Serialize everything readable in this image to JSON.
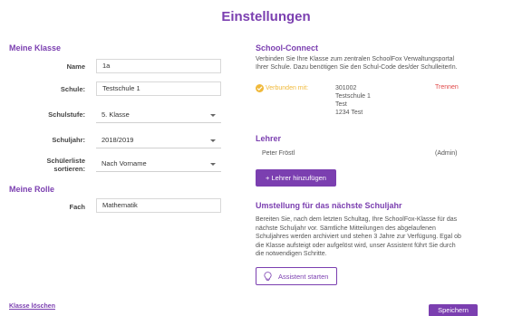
{
  "page": {
    "title": "Einstellungen"
  },
  "my_class": {
    "section_title": "Meine Klasse",
    "name_label": "Name",
    "name_value": "1a",
    "school_label": "Schule:",
    "school_value": "Testschule 1",
    "level_label": "Schulstufe:",
    "level_value": "5. Klasse",
    "year_label": "Schuljahr:",
    "year_value": "2018/2019",
    "sort_label_line1": "Schülerliste",
    "sort_label_line2": "sortieren:",
    "sort_value": "Nach Vorname"
  },
  "my_role": {
    "section_title": "Meine Rolle",
    "subject_label": "Fach",
    "subject_value": "Mathematik"
  },
  "school_connect": {
    "section_title": "School-Connect",
    "description_line1": "Verbinden Sie Ihre Klasse zum zentralen SchoolFox Verwaltungsportal",
    "description_line2": "Ihrer Schule. Dazu benötigen Sie den Schul-Code des/der SchulleiterIn.",
    "status": "Verbunden mit:",
    "school_code": "301002",
    "school_name": "Testschule 1",
    "school_city": "Test",
    "school_zip_city": "1234 Test",
    "disconnect_label": "Trennen"
  },
  "teachers": {
    "section_title": "Lehrer",
    "teacher_name": "Peter Fröstl",
    "teacher_role": "(Admin)",
    "add_button": "+ Lehrer hinzufügen"
  },
  "year_change": {
    "section_title": "Umstellung für das nächste Schuljahr",
    "line1": "Bereiten Sie, nach dem letzten Schultag, Ihre SchoolFox-Klasse für das",
    "line2": "nächste Schuljahr vor. Sämtliche Mitteilungen des abgelaufenen",
    "line3": "Schuljahres werden archiviert und stehen 3 Jahre zur Verfügung. Egal ob",
    "line4": "die Klasse aufsteigt oder aufgelöst wird, unser Assistent führt Sie durch",
    "line5": "die notwendigen Schritte.",
    "assistant_button": "Assistent starten"
  },
  "footer": {
    "delete_class": "Klasse löschen",
    "save_button": "Speichern"
  },
  "colors": {
    "accent": "#7b3fb0",
    "warning": "#f0b93a",
    "danger": "#e04848"
  }
}
